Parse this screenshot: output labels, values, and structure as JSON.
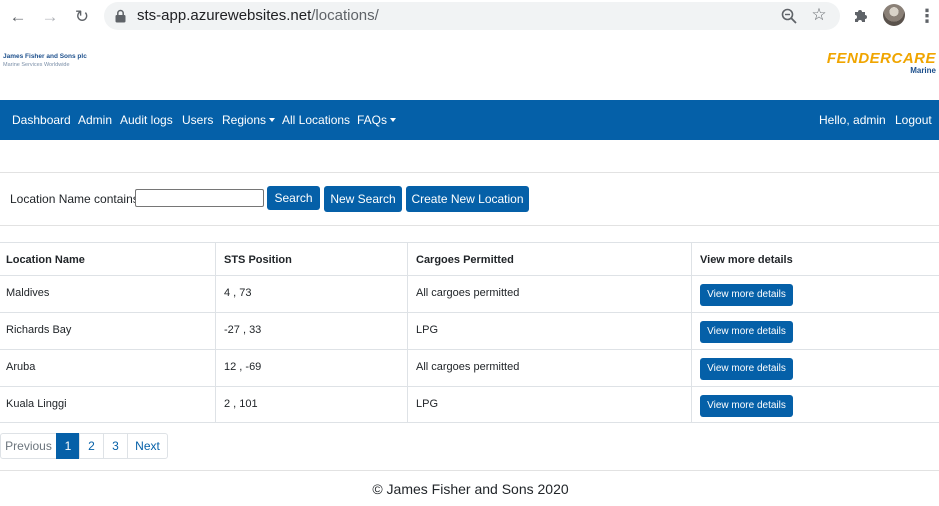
{
  "browser": {
    "url_host": "sts-app.azurewebsites.net",
    "url_path": "/locations/"
  },
  "header": {
    "left_logo_line1": "James Fisher and Sons plc",
    "left_logo_line2": "Marine Services Worldwide",
    "right_logo_line1": "FENDERCARE",
    "right_logo_line2": "Marine"
  },
  "navbar": {
    "items": [
      {
        "label": "Dashboard"
      },
      {
        "label": "Admin"
      },
      {
        "label": "Audit logs"
      },
      {
        "label": "Users"
      },
      {
        "label": "Regions"
      },
      {
        "label": "All Locations"
      },
      {
        "label": "FAQs"
      }
    ],
    "greeting": "Hello, admin",
    "logout": "Logout"
  },
  "search": {
    "label": "Location Name contains:",
    "value": "",
    "search_button": "Search",
    "new_search_button": "New Search",
    "create_button": "Create New Location"
  },
  "table": {
    "headers": [
      "Location Name",
      "STS Position",
      "Cargoes Permitted",
      "View more details"
    ],
    "rows": [
      {
        "name": "Maldives",
        "position": "4 , 73",
        "cargoes": "All cargoes permitted",
        "button": "View more details"
      },
      {
        "name": "Richards Bay",
        "position": "-27 , 33",
        "cargoes": "LPG",
        "button": "View more details"
      },
      {
        "name": "Aruba",
        "position": "12 , -69",
        "cargoes": "All cargoes permitted",
        "button": "View more details"
      },
      {
        "name": "Kuala Linggi",
        "position": "2 , 101",
        "cargoes": "LPG",
        "button": "View more details"
      }
    ]
  },
  "pagination": {
    "previous": "Previous",
    "pages": [
      "1",
      "2",
      "3"
    ],
    "current": "1",
    "next": "Next"
  },
  "footer": {
    "text": "© James Fisher and Sons 2020"
  },
  "colors": {
    "primary": "#0560a8",
    "logo_orange": "#f0a500"
  }
}
